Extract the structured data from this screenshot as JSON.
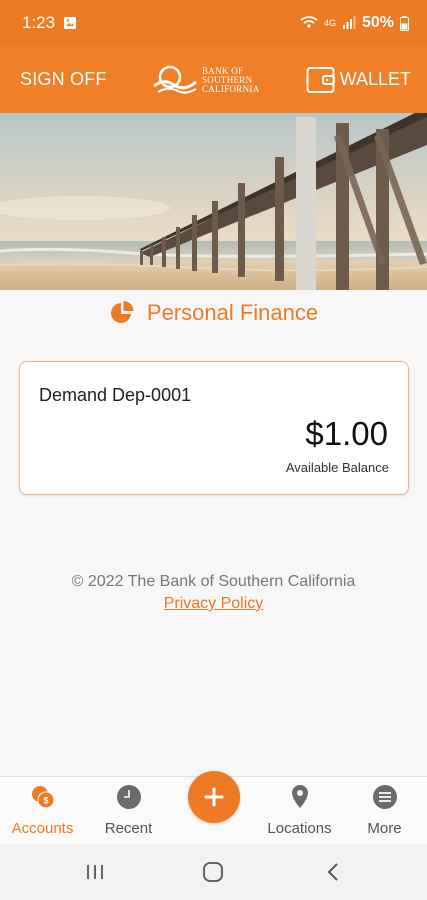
{
  "status_bar": {
    "time": "1:23",
    "network": "4G",
    "battery": "50%"
  },
  "header": {
    "sign_off_label": "SIGN OFF",
    "logo_line1": "BANK OF",
    "logo_line2": "SOUTHERN",
    "logo_line3": "CALIFORNIA",
    "wallet_label": "WALLET"
  },
  "section": {
    "title": "Personal Finance"
  },
  "accounts": [
    {
      "name": "Demand Dep-0001",
      "balance": "$1.00",
      "balance_label": "Available Balance"
    }
  ],
  "footer": {
    "copyright": "© 2022 The Bank of Southern California",
    "privacy_label": "Privacy Policy"
  },
  "bottom_nav": {
    "items": [
      {
        "label": "Accounts",
        "icon": "accounts-icon",
        "active": true
      },
      {
        "label": "Recent",
        "icon": "clock-icon",
        "active": false
      },
      {
        "label": "",
        "icon": "plus-icon",
        "active": false
      },
      {
        "label": "Locations",
        "icon": "location-pin-icon",
        "active": false
      },
      {
        "label": "More",
        "icon": "menu-icon",
        "active": false
      }
    ]
  },
  "colors": {
    "brand": "#f07f27",
    "status_bar": "#ed7b23",
    "accent_text": "#ef7a24"
  }
}
